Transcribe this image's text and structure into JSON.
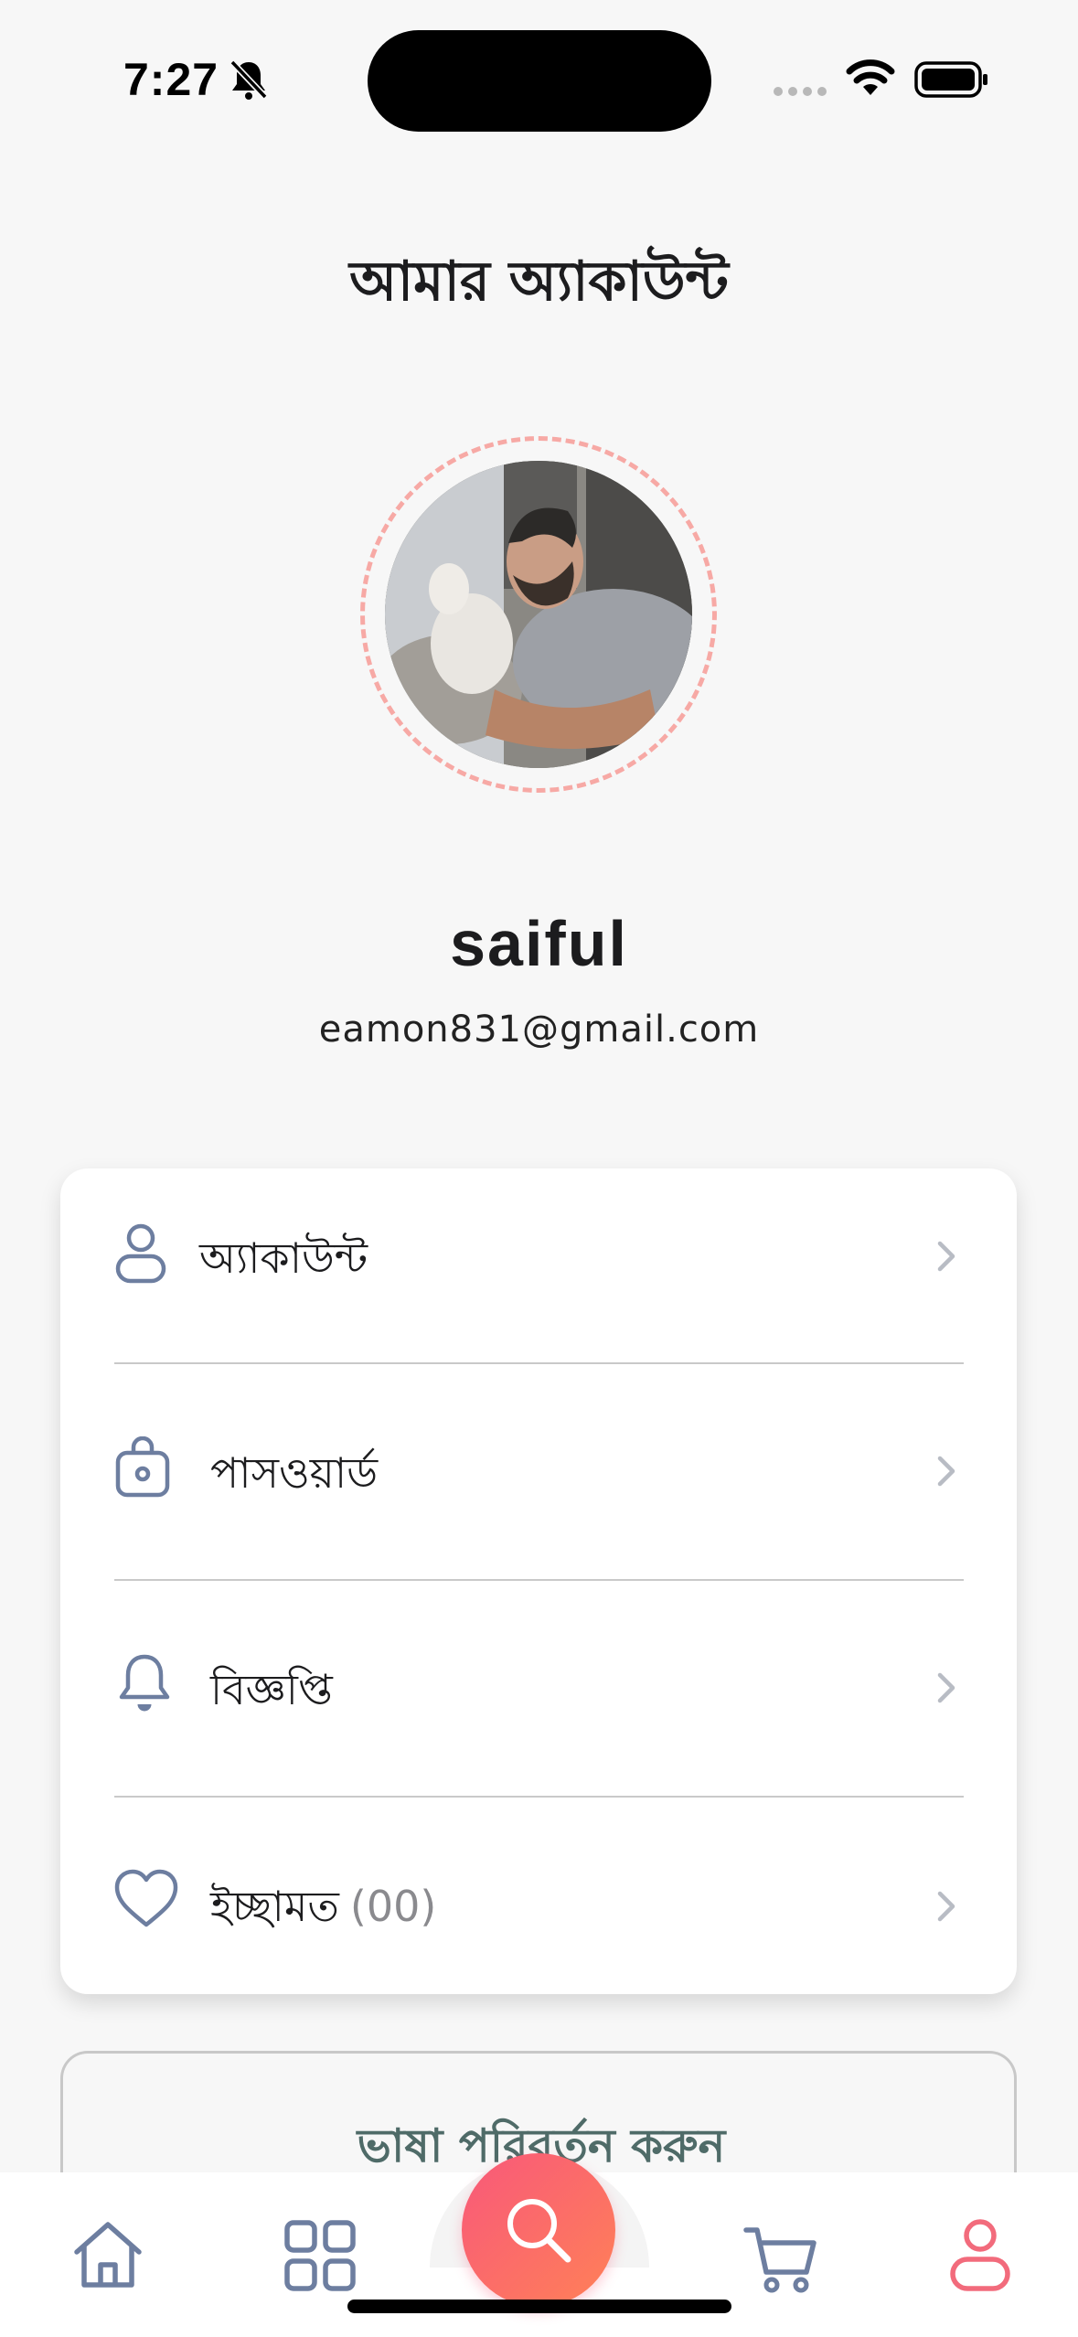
{
  "status_bar": {
    "time": "7:27"
  },
  "header": {
    "title": "আমার অ্যাকাউন্ট"
  },
  "profile": {
    "name": "saiful",
    "email": "eamon831@gmail.com"
  },
  "menu": {
    "items": [
      {
        "label": "অ্যাকাউন্ট",
        "icon": "user-icon"
      },
      {
        "label": "পাসওয়ার্ড",
        "icon": "lock-icon"
      },
      {
        "label": "বিজ্ঞপ্তি",
        "icon": "bell-icon"
      },
      {
        "label": "ইচ্ছামত",
        "count": "(00)",
        "icon": "heart-icon"
      }
    ]
  },
  "language_button": {
    "label": "ভাষা পরিবর্তন করুন"
  },
  "bottom_nav": {
    "items": [
      "home-icon",
      "grid-icon",
      "search-icon",
      "cart-icon",
      "user-icon"
    ],
    "active": "user-icon"
  },
  "colors": {
    "accent": "#f26b7c",
    "fab_gradient_start": "#f8587a",
    "fab_gradient_end": "#ff8157",
    "icon": "#6d7ea0",
    "language_text": "#4f6b68"
  }
}
